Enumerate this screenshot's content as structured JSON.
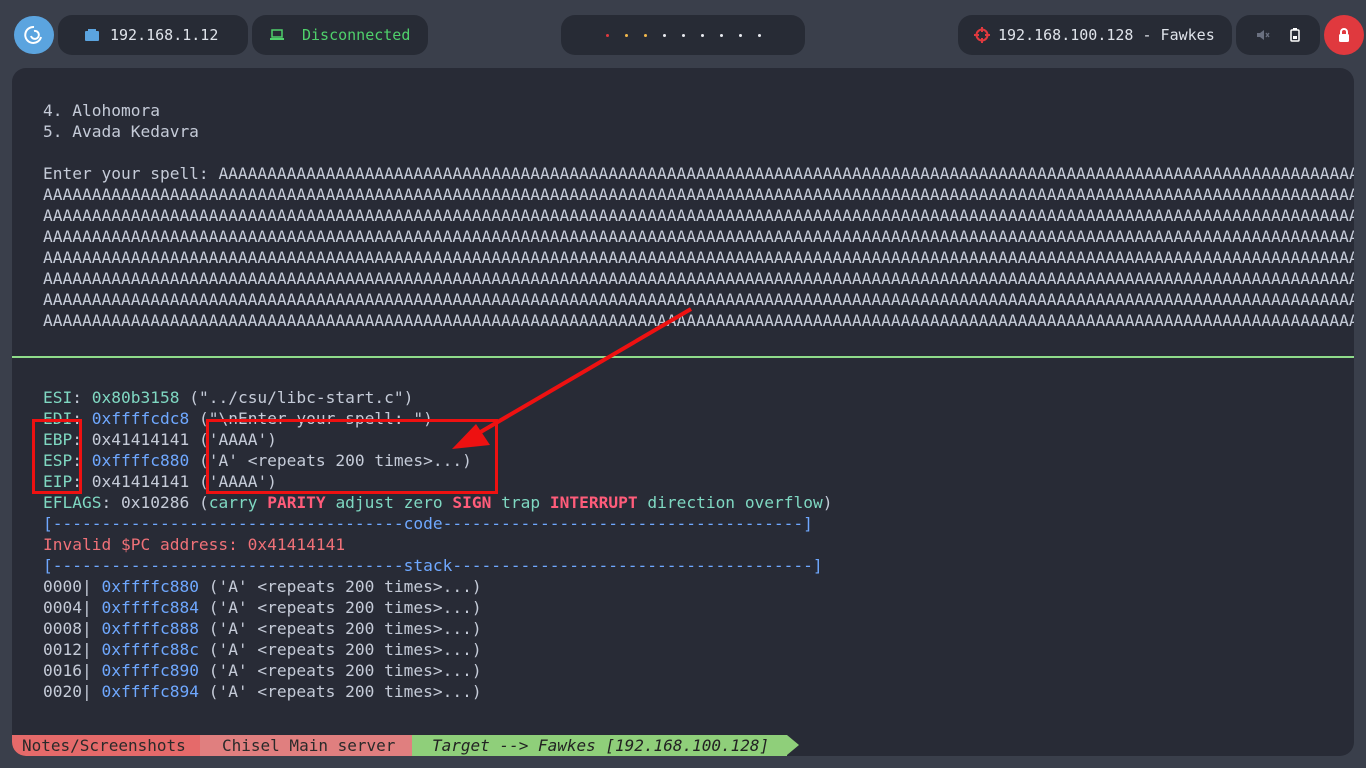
{
  "topbar": {
    "local_ip": "192.168.1.12",
    "vpn_status": "Disconnected",
    "target": "192.168.100.128 - Fawkes",
    "workspace_dot_colors": [
      "#e0393e",
      "#f2b84b",
      "#f2b84b",
      "#e8eaef",
      "#e8eaef",
      "#e8eaef",
      "#e8eaef",
      "#e8eaef",
      "#e8eaef"
    ],
    "icons": {
      "logo": "debian-swirl-icon",
      "local_ip": "network-icon",
      "vpn": "laptop-icon",
      "target": "crosshair-icon",
      "volume": "volume-muted-icon",
      "battery": "battery-icon",
      "power": "power-icon"
    }
  },
  "terminal": {
    "menu": [
      "4. Alohomora",
      "5. Avada Kedavra"
    ],
    "prompt_label": "Enter your spell: ",
    "input_first": "AAAAAAAAAAAAAAAAAAAAAAAAAAAAAAAAAAAAAAAAAAAAAAAAAAAAAAAAAAAAAAAAAAAAAAAAAAAAAAAAAAAAAAAAAAAAAAAAAAAAAAAAAAAAAAAAAAAAAAAAAAAAAAAAAAAAAAAAAAAAAAAAAAAAAAAAAAAAAAAAAAAAAA",
    "input_lines": [
      "AAAAAAAAAAAAAAAAAAAAAAAAAAAAAAAAAAAAAAAAAAAAAAAAAAAAAAAAAAAAAAAAAAAAAAAAAAAAAAAAAAAAAAAAAAAAAAAAAAAAAAAAAAAAAAAAAAAAAAAAAAAAAAAAAAAAAAAAAAAAAAAAAAAAAAAAAAAAAAAAAAAAAAAAAAAAAAAAAAAAAAAAAAAAAAAAAAAAAAAAAAAAAAAAAAAAAAAAAAAAAAAAAAAAAAAAAAAAAAAAAAAAAAAAAA",
      "AAAAAAAAAAAAAAAAAAAAAAAAAAAAAAAAAAAAAAAAAAAAAAAAAAAAAAAAAAAAAAAAAAAAAAAAAAAAAAAAAAAAAAAAAAAAAAAAAAAAAAAAAAAAAAAAAAAAAAAAAAAAAAAAAAAAAAAAAAAAAAAAAAAAAAAAAAAAAAAAAAAAAAAAAAAAAAAAAAAAAAAAAAAAAAAAAAAAAAAAAAAAAAAAAAAAAAAAAAAAAAAAAAAAAAAAAAAAAAAAAAAAAAAAAAAAAAAAAAAAAA",
      "AAAAAAAAAAAAAAAAAAAAAAAAAAAAAAAAAAAAAAAAAAAAAAAAAAAAAAAAAAAAAAAAAAAAAAAAAAAAAAAAAAAAAAAAAAAAAAAAAAAAAAAAAAAAAAAAAAAAAAAAAAAAAAAAAAAAAAAAAAAAAAAAAAAAAAAAAAAAAAAAAAAAAAAAAAAAAAAAAAAAAAAAAAAAAAAAAAAAAAAAAAAAAAAAAAAAAAAAAAAAAAAAAAAAAAAAAAAAAAAAAAAAAAAAAAAAAAAAAAAAAAA",
      "AAAAAAAAAAAAAAAAAAAAAAAAAAAAAAAAAAAAAAAAAAAAAAAAAAAAAAAAAAAAAAAAAAAAAAAAAAAAAAAAAAAAAAAAAAAAAAAAAAAAAAAAAAAAAAAAAAAAAAAAAAAAAAAAAAAAAAAAAAAAAAAAAAAAAAAAAAAAAAAAAAAAAAAAAAAAAAAAAAAAAAAAAAAAAAAAAAAAAAAAAAAAAAAAAAAAAAAAAAAAAAAAAAAAAAAAAAAAAAAAAAAAAAAAAAAAAAAAAAAAAAA",
      "AAAAAAAAAAAAAAAAAAAAAAAAAAAAAAAAAAAAAAAAAAAAAAAAAAAAAAAAAAAAAAAAAAAAAAAAAAAAAAAAAAAAAAAAAAAAAAAAAAAAAAAAAAAAAAAAAAAAAAAAAAAAAAAAAAAAAAAAAAAAAAAAAAAAAAAAAAAAAAAAAAAAAAAAAAAAAAAAAAAAAAAAAAAAAAAAAAAAAAAAAAAAAAAAAAAAAAAAAAAAAAAAAAAAAAAAAAAAAAAAAAAAAAAAAAAAAAAAAAAAAAA",
      "AAAAAAAAAAAAAAAAAAAAAAAAAAAAAAAAAAAAAAAAAAAAAAAAAAAAAAAAAAAAAAAAAAAAAAAAAAAAAAAAAAAAAAAAAAAAAAAAAAAAAAAAAAAAAAAAAAAAAAAAAAAAAAAAAAAAAAAAAAAAAAAAAAAAAAAAAAAAAAAAAAAAAAAAAAAAAAAAAAAAAAAAAAAAAAAAAAAAAAAAAAAAAAAAAAAAAAAAAAAAAAAAAAAAAAAAAAAAAAAAAAAAAAAAAAAAAAAAAAAAAAA",
      "AAAAAAAAAAAAAAAAAAAAAAAAAAAAAAAAAAAAAAAAAAAAAAAAAAAAAAAAAAAAAAAAAAAAAAAAAAAAAAAAAAAAAAAAAAAAAAAAAAAAAAAAAAAAAAAAAAAAAAAAAAAAAAAAAAAAAAAAAAAAAAAAAAAAAAAAAAAAAAAAAAAAAAAAAAAAAAAAAAAAAAAAAAAAAAAAAAAAAAAAAAAAAAAAAAAAAAAAAAAAAAAAAAAAAAAAAAAAAAAAAAAAAAAAAAAAAAAAAAAAAAA",
      "AAAAAAAAAAAAAAAAAAAAAAAAAAAAAAAAAAAAAAAAAAAAAAAAAAAAAAAAAAAAAAAAAAAAAAAAAAAAAAAAAAAAAAAAAAAAAAAAAAAAAAAAAAAAAAAAAAAAAAAAAAAAAAAAAAAAAAAAAAAAAAAAAAAAAAAAAAAAAAAAAAAAAAAAAAAAAAAAAAAAAAAAAAAAAAAAAAAAAAAAAAAAAAAAAAAAAAAAAAAAAAAAAAAAAAAAAAAAAAAAAAAAAAAAAAAAAAAAAAAAAAA"
    ],
    "registers": [
      {
        "name": "ESI",
        "value": "0x80b3158",
        "desc": " (\"../csu/libc-start.c\")"
      },
      {
        "name": "EDI",
        "value": "0xffffcdc8",
        "desc": " (\"\\nEnter your spell: \")"
      },
      {
        "name": "EBP",
        "value": "0x41414141",
        "desc": " ('AAAA')"
      },
      {
        "name": "ESP",
        "value": "0xffffc880",
        "desc": " ('A' <repeats 200 times>...)"
      },
      {
        "name": "EIP",
        "value": "0x41414141",
        "desc": " ('AAAA')"
      }
    ],
    "eflags": {
      "label": "EFLAGS",
      "value": "0x10286",
      "open": " (",
      "flags": [
        {
          "text": "carry",
          "set": false
        },
        {
          "text": "PARITY",
          "set": true
        },
        {
          "text": "adjust",
          "set": false
        },
        {
          "text": "zero",
          "set": false
        },
        {
          "text": "SIGN",
          "set": true
        },
        {
          "text": "trap",
          "set": false
        },
        {
          "text": "INTERRUPT",
          "set": true
        },
        {
          "text": "direction",
          "set": false
        },
        {
          "text": "overflow",
          "set": false
        }
      ],
      "close": ")"
    },
    "code_header": "[------------------------------------code-------------------------------------]",
    "invalid_pc": "Invalid $PC address: 0x41414141",
    "stack_header": "[------------------------------------stack-------------------------------------]",
    "stack": [
      {
        "offset": "0000|",
        "addr": "0xffffc880",
        "val": " ('A' <repeats 200 times>...)"
      },
      {
        "offset": "0004|",
        "addr": "0xffffc884",
        "val": " ('A' <repeats 200 times>...)"
      },
      {
        "offset": "0008|",
        "addr": "0xffffc888",
        "val": " ('A' <repeats 200 times>...)"
      },
      {
        "offset": "0012|",
        "addr": "0xffffc88c",
        "val": " ('A' <repeats 200 times>...)"
      },
      {
        "offset": "0016|",
        "addr": "0xffffc890",
        "val": " ('A' <repeats 200 times>...)"
      },
      {
        "offset": "0020|",
        "addr": "0xffffc894",
        "val": " ('A' <repeats 200 times>...)"
      }
    ]
  },
  "statusbar": {
    "segments": [
      "Notes/Screenshots",
      "Chisel Main server",
      "Target --> Fawkes [192.168.100.128]"
    ],
    "colors": [
      "#e56a6a",
      "#e07f7f",
      "#8fcf7a"
    ]
  },
  "annotation": {
    "color": "#ee1111"
  }
}
